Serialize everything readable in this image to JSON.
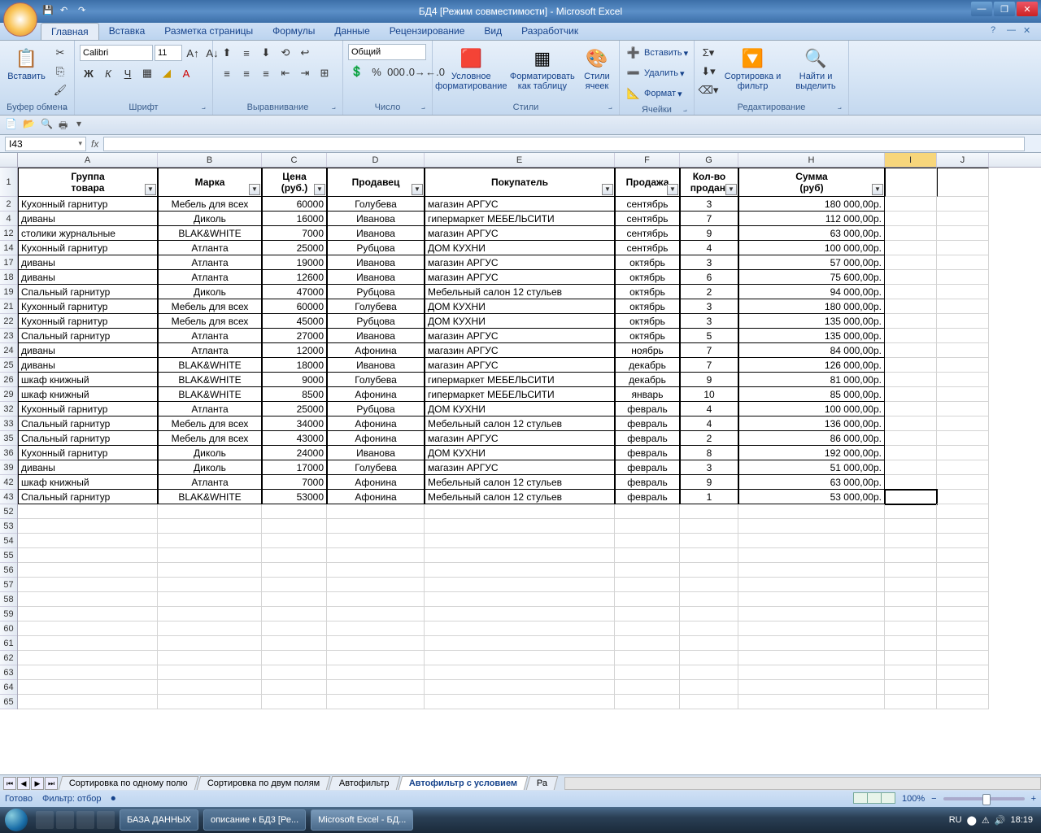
{
  "title": "БД4  [Режим совместимости] - Microsoft Excel",
  "ribbon_tabs": [
    "Главная",
    "Вставка",
    "Разметка страницы",
    "Формулы",
    "Данные",
    "Рецензирование",
    "Вид",
    "Разработчик"
  ],
  "ribbon": {
    "clipboard": {
      "paste": "Вставить",
      "label": "Буфер обмена"
    },
    "font": {
      "name": "Calibri",
      "size": "11",
      "label": "Шрифт"
    },
    "align": {
      "label": "Выравнивание"
    },
    "number": {
      "format": "Общий",
      "label": "Число"
    },
    "styles": {
      "cond": "Условное форматирование",
      "table": "Форматировать как таблицу",
      "cell": "Стили ячеек",
      "label": "Стили"
    },
    "cells": {
      "insert": "Вставить",
      "delete": "Удалить",
      "format": "Формат",
      "label": "Ячейки"
    },
    "editing": {
      "sort": "Сортировка и фильтр",
      "find": "Найти и выделить",
      "label": "Редактирование"
    }
  },
  "namebox": "I43",
  "columns": [
    "A",
    "B",
    "C",
    "D",
    "E",
    "F",
    "G",
    "H",
    "I",
    "J"
  ],
  "selected_col": "I",
  "headers": [
    {
      "l1": "Группа",
      "l2": "товара"
    },
    {
      "l1": "",
      "l2": "Марка"
    },
    {
      "l1": "Цена",
      "l2": "(руб.)"
    },
    {
      "l1": "",
      "l2": "Продавец"
    },
    {
      "l1": "",
      "l2": "Покупатель"
    },
    {
      "l1": "",
      "l2": "Продажа"
    },
    {
      "l1": "Кол-во",
      "l2": "продан."
    },
    {
      "l1": "Сумма",
      "l2": "(руб)"
    }
  ],
  "rows": [
    {
      "n": "2",
      "d": [
        "Кухонный гарнитур",
        "Мебель для всех",
        "60000",
        "Голубева",
        "магазин АРГУС",
        "сентябрь",
        "3",
        "180 000,00р."
      ]
    },
    {
      "n": "4",
      "d": [
        "диваны",
        "Диколь",
        "16000",
        "Иванова",
        "гипермаркет МЕБЕЛЬСИТИ",
        "сентябрь",
        "7",
        "112 000,00р."
      ]
    },
    {
      "n": "12",
      "d": [
        "столики журнальные",
        "BLAK&WHITE",
        "7000",
        "Иванова",
        "магазин АРГУС",
        "сентябрь",
        "9",
        "63 000,00р."
      ]
    },
    {
      "n": "14",
      "d": [
        "Кухонный гарнитур",
        "Атланта",
        "25000",
        "Рубцова",
        "ДОМ КУХНИ",
        "сентябрь",
        "4",
        "100 000,00р."
      ]
    },
    {
      "n": "17",
      "d": [
        "диваны",
        "Атланта",
        "19000",
        "Иванова",
        "магазин АРГУС",
        "октябрь",
        "3",
        "57 000,00р."
      ]
    },
    {
      "n": "18",
      "d": [
        "диваны",
        "Атланта",
        "12600",
        "Иванова",
        "магазин АРГУС",
        "октябрь",
        "6",
        "75 600,00р."
      ]
    },
    {
      "n": "19",
      "d": [
        "Спальный гарнитур",
        "Диколь",
        "47000",
        "Рубцова",
        "Мебельный салон 12 стульев",
        "октябрь",
        "2",
        "94 000,00р."
      ]
    },
    {
      "n": "21",
      "d": [
        "Кухонный гарнитур",
        "Мебель для всех",
        "60000",
        "Голубева",
        "ДОМ КУХНИ",
        "октябрь",
        "3",
        "180 000,00р."
      ]
    },
    {
      "n": "22",
      "d": [
        "Кухонный гарнитур",
        "Мебель для всех",
        "45000",
        "Рубцова",
        "ДОМ КУХНИ",
        "октябрь",
        "3",
        "135 000,00р."
      ]
    },
    {
      "n": "23",
      "d": [
        "Спальный гарнитур",
        "Атланта",
        "27000",
        "Иванова",
        "магазин АРГУС",
        "октябрь",
        "5",
        "135 000,00р."
      ]
    },
    {
      "n": "24",
      "d": [
        "диваны",
        "Атланта",
        "12000",
        "Афонина",
        "магазин АРГУС",
        "ноябрь",
        "7",
        "84 000,00р."
      ]
    },
    {
      "n": "25",
      "d": [
        "диваны",
        "BLAK&WHITE",
        "18000",
        "Иванова",
        "магазин АРГУС",
        "декабрь",
        "7",
        "126 000,00р."
      ]
    },
    {
      "n": "26",
      "d": [
        "шкаф книжный",
        "BLAK&WHITE",
        "9000",
        "Голубева",
        "гипермаркет МЕБЕЛЬСИТИ",
        "декабрь",
        "9",
        "81 000,00р."
      ]
    },
    {
      "n": "29",
      "d": [
        "шкаф книжный",
        "BLAK&WHITE",
        "8500",
        "Афонина",
        "гипермаркет МЕБЕЛЬСИТИ",
        "январь",
        "10",
        "85 000,00р."
      ]
    },
    {
      "n": "32",
      "d": [
        "Кухонный гарнитур",
        "Атланта",
        "25000",
        "Рубцова",
        "ДОМ КУХНИ",
        "февраль",
        "4",
        "100 000,00р."
      ]
    },
    {
      "n": "33",
      "d": [
        "Спальный гарнитур",
        "Мебель для всех",
        "34000",
        "Афонина",
        "Мебельный салон 12 стульев",
        "февраль",
        "4",
        "136 000,00р."
      ]
    },
    {
      "n": "35",
      "d": [
        "Спальный гарнитур",
        "Мебель для всех",
        "43000",
        "Афонина",
        "магазин АРГУС",
        "февраль",
        "2",
        "86 000,00р."
      ]
    },
    {
      "n": "36",
      "d": [
        "Кухонный гарнитур",
        "Диколь",
        "24000",
        "Иванова",
        "ДОМ КУХНИ",
        "февраль",
        "8",
        "192 000,00р."
      ]
    },
    {
      "n": "39",
      "d": [
        "диваны",
        "Диколь",
        "17000",
        "Голубева",
        "магазин АРГУС",
        "февраль",
        "3",
        "51 000,00р."
      ]
    },
    {
      "n": "42",
      "d": [
        "шкаф книжный",
        "Атланта",
        "7000",
        "Афонина",
        "Мебельный салон 12 стульев",
        "февраль",
        "9",
        "63 000,00р."
      ]
    },
    {
      "n": "43",
      "d": [
        "Спальный гарнитур",
        "BLAK&WHITE",
        "53000",
        "Афонина",
        "Мебельный салон 12 стульев",
        "февраль",
        "1",
        "53 000,00р."
      ]
    }
  ],
  "empty_rows": [
    "52",
    "53",
    "54",
    "55",
    "56",
    "57",
    "58",
    "59",
    "60",
    "61",
    "62",
    "63",
    "64",
    "65"
  ],
  "sheet_tabs": [
    "Сортировка по одному полю",
    "Сортировка по двум полям",
    "Автофильтр",
    "Автофильтр с условием",
    "Ра"
  ],
  "active_sheet": 3,
  "status": {
    "ready": "Готово",
    "filter": "Фильтр: отбор",
    "zoom": "100%"
  },
  "taskbar": {
    "items": [
      "БАЗА ДАННЫХ",
      "описание к БД3 [Ре...",
      "Microsoft Excel - БД..."
    ],
    "lang": "RU",
    "time": "18:19"
  }
}
